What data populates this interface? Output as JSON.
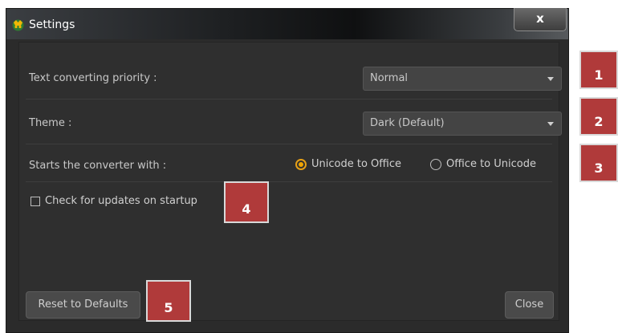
{
  "window": {
    "title": "Settings",
    "close_label": "x"
  },
  "settings": {
    "priority_label": "Text converting priority :",
    "priority_value": "Normal",
    "theme_label": "Theme :",
    "theme_value": "Dark (Default)",
    "start_label": "Starts the converter with :",
    "radio_options": [
      "Unicode to Office",
      "Office to Unicode"
    ],
    "radio_selected": "Unicode to Office",
    "check_updates_label": "Check for updates on startup",
    "check_updates_checked": false
  },
  "buttons": {
    "reset_label": "Reset to Defaults",
    "close_label": "Close"
  },
  "badges": [
    "1",
    "2",
    "3",
    "4",
    "5"
  ],
  "colors": {
    "background": "#2b2b2b",
    "accent": "#f0a500",
    "badge": "#b03a3a"
  }
}
